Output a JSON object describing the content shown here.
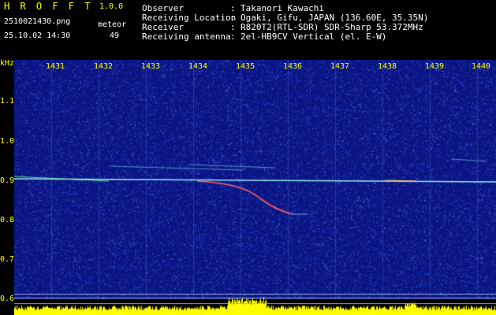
{
  "app": {
    "title": "H R O F F T",
    "version": "1.0.0",
    "filename": "2510021430.png",
    "datetime": "25.10.02 14:30",
    "detection_label": "meteor",
    "detection_count": "49"
  },
  "station_info": [
    {
      "key": "Observer",
      "value": "Takanori Kawachi"
    },
    {
      "key": "Receiving Location",
      "value": "Ogaki, Gifu, JAPAN (136.60E, 35.35N)"
    },
    {
      "key": "Receiver",
      "value": "R820T2(RTL-SDR) SDR-Sharp 53.372MHz"
    },
    {
      "key": "Receiving antenna",
      "value": "2el-HB9CV Vertical (el. E-W)"
    }
  ],
  "spectrogram": {
    "y_unit": "kHz",
    "y_ticks": [
      "1.1",
      "1.0",
      "0.9",
      "0.8",
      "0.7",
      "0.6"
    ],
    "x_ticks": [
      "1431",
      "1432",
      "1433",
      "1434",
      "1435",
      "1436",
      "1437",
      "1438",
      "1439",
      "1440"
    ],
    "colors": {
      "background": "#0a1480",
      "noise": "#2a55e0",
      "carrier": "#9ae8f0",
      "meteor": "#ff6060",
      "level_bar": "#ffff00",
      "reference_line": "#9ab0e0",
      "tick_text": "#ffff00"
    }
  }
}
